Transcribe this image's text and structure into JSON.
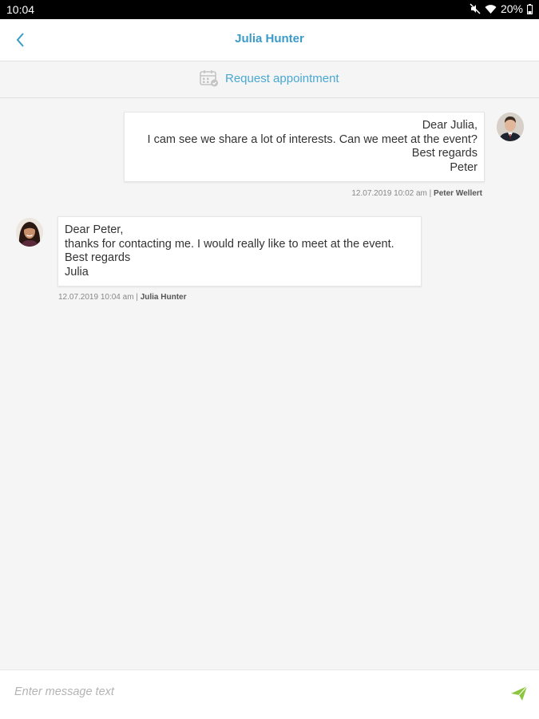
{
  "status_bar": {
    "time": "10:04",
    "battery": "20%",
    "icons": [
      "mute-icon",
      "wifi-icon",
      "battery-icon"
    ]
  },
  "header": {
    "title": "Julia Hunter",
    "back_icon": "chevron-left-icon",
    "accent_color": "#3a9bc8"
  },
  "appointment": {
    "label": "Request appointment",
    "icon": "calendar-icon"
  },
  "messages": [
    {
      "direction": "outgoing",
      "lines": [
        "Dear Julia,",
        "I cam see we share a lot of interests. Can we meet at the event?",
        "Best regards",
        "Peter"
      ],
      "timestamp": "12.07.2019 10:02 am",
      "separator": " | ",
      "sender": "Peter Wellert"
    },
    {
      "direction": "incoming",
      "lines": [
        "Dear Peter,",
        "thanks for contacting me. I would really like to meet at the event.",
        "Best regards",
        "Julia"
      ],
      "timestamp": "12.07.2019 10:04 am",
      "separator": " | ",
      "sender": "Julia Hunter"
    }
  ],
  "composer": {
    "placeholder": "Enter message text",
    "value": "",
    "send_icon": "send-icon",
    "send_color": "#8cc63f"
  }
}
